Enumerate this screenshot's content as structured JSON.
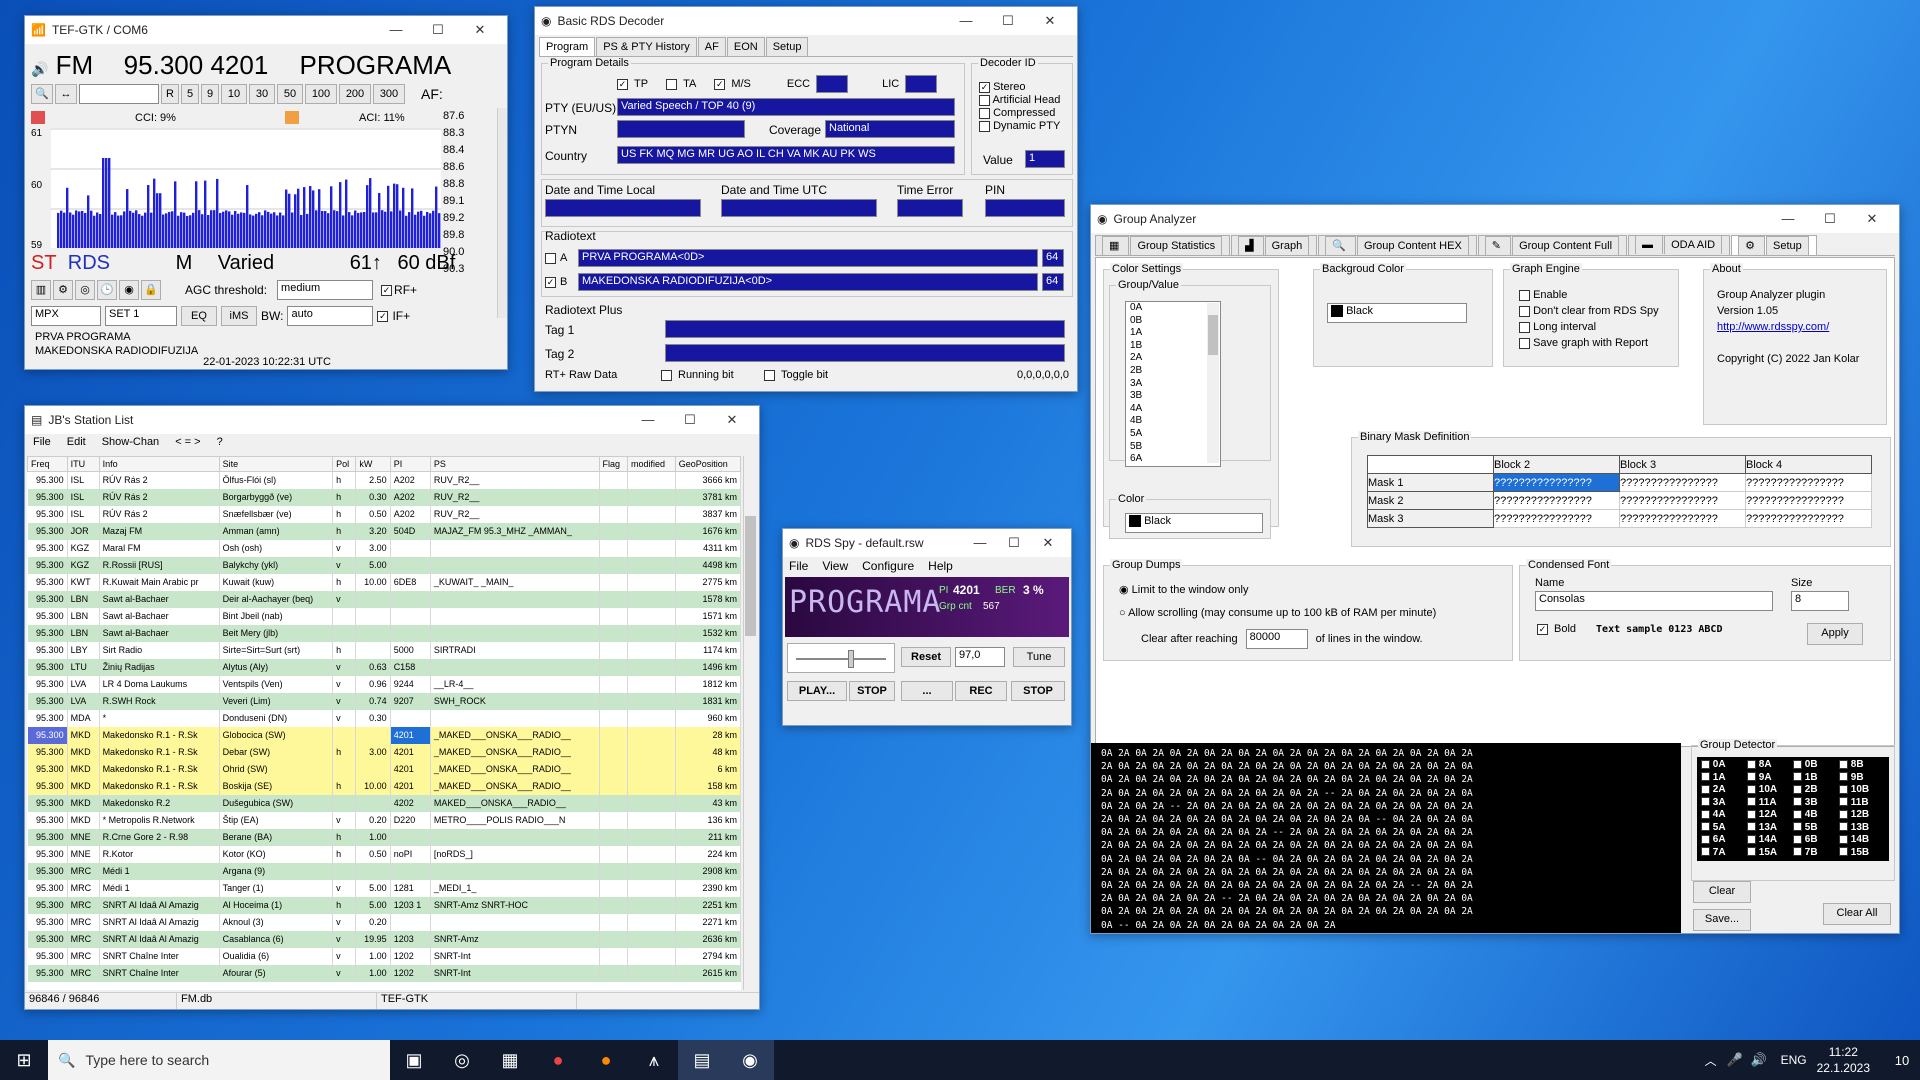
{
  "tef": {
    "title": "TEF-GTK / COM6",
    "band": "FM",
    "freq": "95.300",
    "pi": "4201",
    "ps": "PROGRAMA",
    "af_label": "AF:",
    "cci": "CCI: 9%",
    "aci": "ACI: 11%",
    "scale_top": "61",
    "scale_mid": "60",
    "scale_bot": "59",
    "st": "ST",
    "rds": "RDS",
    "mode": "M",
    "pty": "Varied",
    "sig": "61↑",
    "dbf": "60 dBf",
    "agc_label": "AGC threshold:",
    "agc_value": "medium",
    "rf": "RF+",
    "if": "IF+",
    "mpx": "MPX",
    "set": "SET 1",
    "eq": "EQ",
    "ims": "iMS",
    "bw_label": "BW:",
    "bw_value": "auto",
    "rt1": "PRVA PROGRAMA",
    "rt2": "MAKEDONSKA RADIODIFUZIJA",
    "datetime": "22-01-2023 10:22:31 UTC",
    "steps": [
      "R",
      "5",
      "9",
      "10",
      "30",
      "50",
      "100",
      "200",
      "300"
    ],
    "af_list": [
      "87.6",
      "88.3",
      "88.4",
      "88.6",
      "88.8",
      "89.1",
      "89.2",
      "89.8",
      "90.0",
      "90.3"
    ]
  },
  "rds": {
    "title": "Basic RDS Decoder",
    "tabs": [
      "Program",
      "PS & PTY History",
      "AF",
      "EON",
      "Setup"
    ],
    "program_details": "Program Details",
    "tp": "TP",
    "ta": "TA",
    "ms": "M/S",
    "ecc": "ECC",
    "lic": "LIC",
    "pty_label": "PTY (EU/US)",
    "pty_value": "Varied Speech / TOP 40 (9)",
    "ptyn_label": "PTYN",
    "coverage_label": "Coverage",
    "coverage_value": "National",
    "country_label": "Country",
    "country_value": "US FK MQ MG MR UG AO IL CH VA MK AU PK WS",
    "decoder_id": "Decoder ID",
    "stereo": "Stereo",
    "art_head": "Artificial Head",
    "compressed": "Compressed",
    "dyn_pty": "Dynamic PTY",
    "value_label": "Value",
    "value": "1",
    "dt_local": "Date and Time Local",
    "dt_utc": "Date and Time UTC",
    "time_error": "Time Error",
    "pin": "PIN",
    "radiotext": "Radiotext",
    "rt_a_label": "A",
    "rt_a": "PRVA PROGRAMA<0D>",
    "rt_a_len": "64",
    "rt_b_label": "B",
    "rt_b": "MAKEDONSKA RADIODIFUZIJA<0D>",
    "rt_b_len": "64",
    "rtplus": "Radiotext Plus",
    "tag1": "Tag 1",
    "tag2": "Tag 2",
    "raw": "RT+ Raw Data",
    "running": "Running bit",
    "toggle": "Toggle bit",
    "raw_value": "0,0,0,0,0,0"
  },
  "station": {
    "title": "JB's Station List",
    "menu": [
      "File",
      "Edit",
      "Show-Chan",
      "< = >",
      "?"
    ],
    "columns": [
      "Freq",
      "ITU",
      "Info",
      "Site",
      "Pol",
      "kW",
      "PI",
      "PS",
      "Flag",
      "modified",
      "GeoPosition"
    ],
    "rows": [
      [
        "95.300",
        "ISL",
        "RÚV Rás 2",
        "Ölfus-Flói (sl)",
        "h",
        "2.50",
        "A202",
        "RUV_R2__",
        "",
        "",
        "3666 km"
      ],
      [
        "95.300",
        "ISL",
        "RÚV Rás 2",
        "Borgarbyggð (ve)",
        "h",
        "0.30",
        "A202",
        "RUV_R2__",
        "",
        "",
        "3781 km"
      ],
      [
        "95.300",
        "ISL",
        "RÚV Rás 2",
        "Snæfellsbær (ve)",
        "h",
        "0.50",
        "A202",
        "RUV_R2__",
        "",
        "",
        "3837 km"
      ],
      [
        "95.300",
        "JOR",
        "Mazaj FM",
        "Amman (amn)",
        "h",
        "3.20",
        "504D",
        "MAJAZ_FM 95.3_MHZ _AMMAN_",
        "",
        "",
        "1676 km"
      ],
      [
        "95.300",
        "KGZ",
        "Maral FM",
        "Osh (osh)",
        "v",
        "3.00",
        "",
        "",
        "",
        "",
        "4311 km"
      ],
      [
        "95.300",
        "KGZ",
        "R.Rossii [RUS]",
        "Balykchy (ykl)",
        "v",
        "5.00",
        "",
        "",
        "",
        "",
        "4498 km"
      ],
      [
        "95.300",
        "KWT",
        "R.Kuwait Main Arabic pr",
        "Kuwait (kuw)",
        "h",
        "10.00",
        "6DE8",
        "_KUWAIT_ _MAIN_",
        "",
        "",
        "2775 km"
      ],
      [
        "95.300",
        "LBN",
        "Sawt al-Bachaer",
        "Deir al-Aachayer (beq)",
        "v",
        "",
        "",
        "",
        "",
        "",
        "1578 km"
      ],
      [
        "95.300",
        "LBN",
        "Sawt al-Bachaer",
        "Bint Jbeil (nab)",
        "",
        "",
        "",
        "",
        "",
        "",
        "1571 km"
      ],
      [
        "95.300",
        "LBN",
        "Sawt al-Bachaer",
        "Beit Mery (jlb)",
        "",
        "",
        "",
        "",
        "",
        "",
        "1532 km"
      ],
      [
        "95.300",
        "LBY",
        "Sirt Radio",
        "Sirte=Sirt=Surt (srt)",
        "h",
        "",
        "5000",
        "SIRTRADI",
        "",
        "",
        "1174 km"
      ],
      [
        "95.300",
        "LTU",
        "Žinių Radijas",
        "Alytus (Aly)",
        "v",
        "0.63",
        "C158",
        "",
        "",
        "",
        "1496 km"
      ],
      [
        "95.300",
        "LVA",
        "LR 4 Doma Laukums",
        "Ventspils (Ven)",
        "v",
        "0.96",
        "9244",
        "__LR-4__",
        "",
        "",
        "1812 km"
      ],
      [
        "95.300",
        "LVA",
        "R.SWH Rock",
        "Veveri (Lim)",
        "v",
        "0.74",
        "9207",
        "SWH_ROCK",
        "",
        "",
        "1831 km"
      ],
      [
        "95.300",
        "MDA",
        "*",
        "Donduseni (DN)",
        "v",
        "0.30",
        "",
        "",
        "",
        "",
        "960 km"
      ],
      [
        "95.300",
        "MKD",
        "Makedonsko R.1 - R.Sk",
        "Globocica (SW)",
        "",
        "",
        "4201",
        "_MAKED___ONSKA___RADIO__",
        "",
        "",
        "28 km"
      ],
      [
        "95.300",
        "MKD",
        "Makedonsko R.1 - R.Sk",
        "Debar (SW)",
        "h",
        "3.00",
        "4201",
        "_MAKED___ONSKA___RADIO__",
        "",
        "",
        "48 km"
      ],
      [
        "95.300",
        "MKD",
        "Makedonsko R.1 - R.Sk",
        "Ohrid (SW)",
        "",
        "",
        "4201",
        "_MAKED___ONSKA___RADIO__",
        "",
        "",
        "6 km"
      ],
      [
        "95.300",
        "MKD",
        "Makedonsko R.1 - R.Sk",
        "Boskija (SE)",
        "h",
        "10.00",
        "4201",
        "_MAKED___ONSKA___RADIO__",
        "",
        "",
        "158 km"
      ],
      [
        "95.300",
        "MKD",
        "Makedonsko R.2",
        "Dušegubica (SW)",
        "",
        "",
        "4202",
        "MAKED___ONSKA___RADIO__",
        "",
        "",
        "43 km"
      ],
      [
        "95.300",
        "MKD",
        "* Metropolis R.Network",
        "Štip (EA)",
        "v",
        "0.20",
        "D220",
        "METRO____POLIS RADIO___N",
        "",
        "",
        "136 km"
      ],
      [
        "95.300",
        "MNE",
        "R.Crne Gore 2 - R.98",
        "Berane (BA)",
        "h",
        "1.00",
        "",
        "",
        "",
        "",
        "211 km"
      ],
      [
        "95.300",
        "MNE",
        "R.Kotor",
        "Kotor (KO)",
        "h",
        "0.50",
        "noPI",
        "[noRDS_]",
        "",
        "",
        "224 km"
      ],
      [
        "95.300",
        "MRC",
        "Médi 1",
        "Argana (9)",
        "",
        "",
        "",
        "",
        "",
        "",
        "2908 km"
      ],
      [
        "95.300",
        "MRC",
        "Médi 1",
        "Tanger (1)",
        "v",
        "5.00",
        "1281",
        "_MEDI_1_",
        "",
        "",
        "2390 km"
      ],
      [
        "95.300",
        "MRC",
        "SNRT Al Idaâ Al Amazig",
        "Al Hoceima (1)",
        "h",
        "5.00",
        "1203 1",
        "SNRT-Amz SNRT-HOC",
        "",
        "",
        "2251 km"
      ],
      [
        "95.300",
        "MRC",
        "SNRT Al Idaâ Al Amazig",
        "Aknoul (3)",
        "v",
        "0.20",
        "",
        "",
        "",
        "",
        "2271 km"
      ],
      [
        "95.300",
        "MRC",
        "SNRT Al Idaâ Al Amazig",
        "Casablanca (6)",
        "v",
        "19.95",
        "1203",
        "SNRT-Amz",
        "",
        "",
        "2636 km"
      ],
      [
        "95.300",
        "MRC",
        "SNRT Chaîne Inter",
        "Oualidia (6)",
        "v",
        "1.00",
        "1202",
        "SNRT-Int",
        "",
        "",
        "2794 km"
      ],
      [
        "95.300",
        "MRC",
        "SNRT Chaîne Inter",
        "Afourar (5)",
        "v",
        "1.00",
        "1202",
        "SNRT-Int",
        "",
        "",
        "2615 km"
      ]
    ],
    "status": [
      "96846 / 96846",
      "FM.db",
      "TEF-GTK"
    ]
  },
  "spy": {
    "title": "RDS Spy - default.rsw",
    "menu": [
      "File",
      "View",
      "Configure",
      "Help"
    ],
    "ps": "PROGRAMA",
    "pi_label": "PI",
    "pi": "4201",
    "ber_label": "BER",
    "ber": "3 %",
    "grp_label": "Grp cnt",
    "grp": "567",
    "reset": "Reset",
    "speed": "97,0",
    "tune": "Tune",
    "play": "PLAY...",
    "stop1": "STOP",
    "dots": "...",
    "rec": "REC",
    "stop2": "STOP"
  },
  "ga": {
    "title": "Group Analyzer",
    "tabs": [
      "Group Statistics",
      "Graph",
      "Group Content HEX",
      "Group Content Full",
      "ODA AID",
      "Setup"
    ],
    "color_settings": "Color Settings",
    "group_value": "Group/Value",
    "groups": [
      "0A",
      "0B",
      "1A",
      "1B",
      "2A",
      "2B",
      "3A",
      "3B",
      "4A",
      "4B",
      "5A",
      "5B",
      "6A"
    ],
    "color_label": "Color",
    "color_value": "Black",
    "bg_color": "Backgroud Color",
    "bg_value": "Black",
    "graph_engine": "Graph Engine",
    "enable": "Enable",
    "dont_clear": "Don't clear from RDS Spy",
    "long_interval": "Long interval",
    "save_graph": "Save graph with Report",
    "about": "About",
    "about1": "Group Analyzer plugin",
    "about2": "Version 1.05",
    "about3": "http://www.rdsspy.com/",
    "about4": "Copyright (C) 2022 Jan Kolar",
    "binary_mask": "Binary Mask Definition",
    "mask_cols": [
      "Block 2",
      "Block 3",
      "Block 4"
    ],
    "masks": [
      "Mask 1",
      "Mask 2",
      "Mask 3"
    ],
    "mask_value": "????????????????",
    "group_dumps": "Group Dumps",
    "limit": "Limit to the window only",
    "allow": "Allow scrolling (may consume up to 100 kB of RAM per minute)",
    "clear_after": "Clear after reaching",
    "clear_value": "80000",
    "lines": "of lines in the window.",
    "condensed": "Condensed Font",
    "name_label": "Name",
    "font_value": "Consolas",
    "size_label": "Size",
    "size_value": "8",
    "bold": "Bold",
    "sample": "Text sample 0123 ABCD",
    "apply": "Apply",
    "hex_lines": [
      "0A 2A 0A 2A 0A 2A 0A 2A 0A 2A 0A 2A 0A 2A 0A 2A 0A 2A 0A 2A 0A 2A",
      "2A 0A 2A 0A 2A 0A 2A 0A 2A 0A 2A 0A 2A 0A 2A 0A 2A 0A 2A 0A 2A 0A",
      "0A 2A 0A 2A 0A 2A 0A 2A 0A 2A 0A 2A 0A 2A 0A 2A 0A 2A 0A 2A 0A 2A",
      "2A 0A 2A 0A 2A 0A 2A 0A 2A 0A 2A 0A 2A -- 2A 0A 2A 0A 2A 0A 2A 0A",
      "0A 2A 0A 2A -- 2A 0A 2A 0A 2A 0A 2A 0A 2A 0A 2A 0A 2A 0A 2A 0A 2A",
      "2A 0A 2A 0A 2A 0A 2A 0A 2A 0A 2A 0A 2A 0A 2A 0A -- 0A 2A 0A 2A 0A",
      "0A 2A 0A 2A 0A 2A 0A 2A 0A 2A -- 2A 0A 2A 0A 2A 0A 2A 0A 2A 0A 2A",
      "2A 0A 2A 0A 2A 0A 2A 0A 2A 0A 2A 0A 2A 0A 2A 0A 2A 0A 2A 0A 2A 0A",
      "0A 2A 0A 2A 0A 2A 0A 2A 0A -- 0A 2A 0A 2A 0A 2A 0A 2A 0A 2A 0A 2A",
      "2A 0A 2A 0A 2A 0A 2A 0A 2A 0A 2A 0A 2A 0A 2A 0A 2A 0A 2A 0A 2A 0A",
      "0A 2A 0A 2A 0A 2A 0A 2A 0A 2A 0A 2A 0A 2A 0A 2A 0A 2A -- 2A 0A 2A",
      "2A 0A 2A 0A 2A 0A 2A -- 2A 0A 2A 0A 2A 0A 2A 0A 2A 0A 2A 0A 2A 0A",
      "0A 2A 0A 2A 0A 2A 0A 2A 0A 2A 0A 2A 0A 2A 0A 2A 0A 2A 0A 2A 0A 2A",
      "0A -- 0A 2A 0A 2A 0A 2A 0A 2A 0A 2A 0A 2A"
    ],
    "detector": "Group Detector",
    "det_groups": [
      "0A",
      "8A",
      "0B",
      "8B",
      "1A",
      "9A",
      "1B",
      "9B",
      "2A",
      "10A",
      "2B",
      "10B",
      "3A",
      "11A",
      "3B",
      "11B",
      "4A",
      "12A",
      "4B",
      "12B",
      "5A",
      "13A",
      "5B",
      "13B",
      "6A",
      "14A",
      "6B",
      "14B",
      "7A",
      "15A",
      "7B",
      "15B"
    ],
    "clear": "Clear",
    "save": "Save...",
    "clear_all": "Clear All"
  },
  "taskbar": {
    "search": "Type here to search",
    "lang": "ENG",
    "time": "11:22",
    "date": "22.1.2023",
    "notif": "10"
  },
  "colors": {
    "rds_blue": "#1616a0",
    "tef_blue": "#2020d8",
    "spy_bg": "#3a0a5a",
    "highlight": "#fff89a",
    "green_row": "#c8e6c9"
  }
}
